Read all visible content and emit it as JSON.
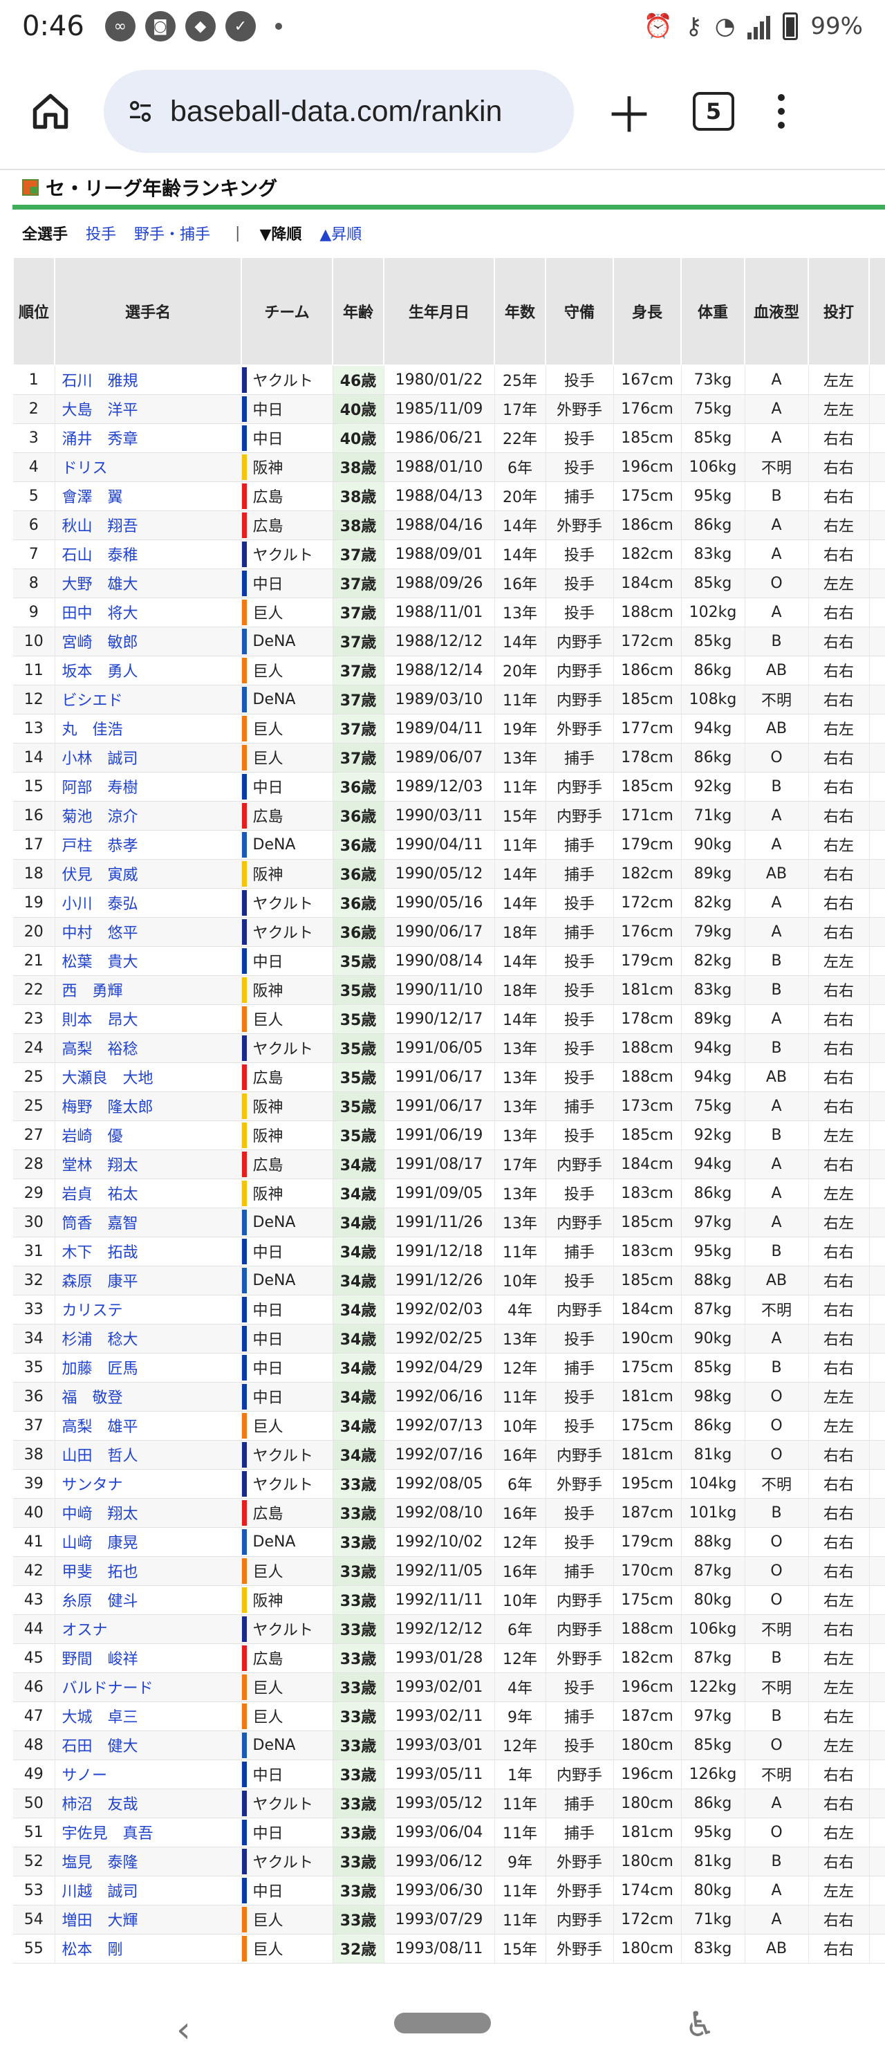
{
  "status": {
    "time": "0:46",
    "battery": "99%"
  },
  "browser": {
    "url": "baseball-data.com/rankin",
    "tab_count": "5"
  },
  "page": {
    "title": "セ・リーグ年齢ランキング",
    "filters": {
      "all": "全選手",
      "pitcher": "投手",
      "fielder": "野手・捕手",
      "sep": "|",
      "desc": "▼降順",
      "asc": "▲昇順"
    }
  },
  "table": {
    "headers": [
      "順位",
      "選手名",
      "チーム",
      "年齢",
      "生年月日",
      "年数",
      "守備",
      "身長",
      "体重",
      "血液型",
      "投打"
    ],
    "team_colors": {
      "ヤクルト": "#1a2a8c",
      "中日": "#0a3aa8",
      "阪神": "#f2c40a",
      "広島": "#e61e1e",
      "巨人": "#f07a10",
      "DeNA": "#1a5ab4"
    },
    "rows": [
      [
        "1",
        "石川　雅規",
        "ヤクルト",
        "46歳",
        "1980/01/22",
        "25年",
        "投手",
        "167cm",
        "73kg",
        "A",
        "左左"
      ],
      [
        "2",
        "大島　洋平",
        "中日",
        "40歳",
        "1985/11/09",
        "17年",
        "外野手",
        "176cm",
        "75kg",
        "A",
        "左左"
      ],
      [
        "3",
        "涌井　秀章",
        "中日",
        "40歳",
        "1986/06/21",
        "22年",
        "投手",
        "185cm",
        "85kg",
        "A",
        "右右"
      ],
      [
        "4",
        "ドリス",
        "阪神",
        "38歳",
        "1988/01/10",
        "6年",
        "投手",
        "196cm",
        "106kg",
        "不明",
        "右右"
      ],
      [
        "5",
        "會澤　翼",
        "広島",
        "38歳",
        "1988/04/13",
        "20年",
        "捕手",
        "175cm",
        "95kg",
        "B",
        "右右"
      ],
      [
        "6",
        "秋山　翔吾",
        "広島",
        "38歳",
        "1988/04/16",
        "14年",
        "外野手",
        "186cm",
        "86kg",
        "A",
        "右左"
      ],
      [
        "7",
        "石山　泰稚",
        "ヤクルト",
        "37歳",
        "1988/09/01",
        "14年",
        "投手",
        "182cm",
        "83kg",
        "A",
        "右右"
      ],
      [
        "8",
        "大野　雄大",
        "中日",
        "37歳",
        "1988/09/26",
        "16年",
        "投手",
        "184cm",
        "85kg",
        "O",
        "左左"
      ],
      [
        "9",
        "田中　将大",
        "巨人",
        "37歳",
        "1988/11/01",
        "13年",
        "投手",
        "188cm",
        "102kg",
        "A",
        "右右"
      ],
      [
        "10",
        "宮崎　敏郎",
        "DeNA",
        "37歳",
        "1988/12/12",
        "14年",
        "内野手",
        "172cm",
        "85kg",
        "B",
        "右右"
      ],
      [
        "11",
        "坂本　勇人",
        "巨人",
        "37歳",
        "1988/12/14",
        "20年",
        "内野手",
        "186cm",
        "86kg",
        "AB",
        "右右"
      ],
      [
        "12",
        "ビシエド",
        "DeNA",
        "37歳",
        "1989/03/10",
        "11年",
        "内野手",
        "185cm",
        "108kg",
        "不明",
        "右右"
      ],
      [
        "13",
        "丸　佳浩",
        "巨人",
        "37歳",
        "1989/04/11",
        "19年",
        "外野手",
        "177cm",
        "94kg",
        "AB",
        "右左"
      ],
      [
        "14",
        "小林　誠司",
        "巨人",
        "37歳",
        "1989/06/07",
        "13年",
        "捕手",
        "178cm",
        "86kg",
        "O",
        "右右"
      ],
      [
        "15",
        "阿部　寿樹",
        "中日",
        "36歳",
        "1989/12/03",
        "11年",
        "内野手",
        "185cm",
        "92kg",
        "B",
        "右右"
      ],
      [
        "16",
        "菊池　涼介",
        "広島",
        "36歳",
        "1990/03/11",
        "15年",
        "内野手",
        "171cm",
        "71kg",
        "A",
        "右右"
      ],
      [
        "17",
        "戸柱　恭孝",
        "DeNA",
        "36歳",
        "1990/04/11",
        "11年",
        "捕手",
        "179cm",
        "90kg",
        "A",
        "右左"
      ],
      [
        "18",
        "伏見　寅威",
        "阪神",
        "36歳",
        "1990/05/12",
        "14年",
        "捕手",
        "182cm",
        "89kg",
        "AB",
        "右右"
      ],
      [
        "19",
        "小川　泰弘",
        "ヤクルト",
        "36歳",
        "1990/05/16",
        "14年",
        "投手",
        "172cm",
        "82kg",
        "A",
        "右右"
      ],
      [
        "20",
        "中村　悠平",
        "ヤクルト",
        "36歳",
        "1990/06/17",
        "18年",
        "捕手",
        "176cm",
        "79kg",
        "A",
        "右右"
      ],
      [
        "21",
        "松葉　貴大",
        "中日",
        "35歳",
        "1990/08/14",
        "14年",
        "投手",
        "179cm",
        "82kg",
        "B",
        "左左"
      ],
      [
        "22",
        "西　勇輝",
        "阪神",
        "35歳",
        "1990/11/10",
        "18年",
        "投手",
        "181cm",
        "83kg",
        "B",
        "右右"
      ],
      [
        "23",
        "則本　昂大",
        "巨人",
        "35歳",
        "1990/12/17",
        "14年",
        "投手",
        "178cm",
        "89kg",
        "A",
        "右右"
      ],
      [
        "24",
        "高梨　裕稔",
        "ヤクルト",
        "35歳",
        "1991/06/05",
        "13年",
        "投手",
        "188cm",
        "94kg",
        "B",
        "右右"
      ],
      [
        "25",
        "大瀬良　大地",
        "広島",
        "35歳",
        "1991/06/17",
        "13年",
        "投手",
        "188cm",
        "94kg",
        "AB",
        "右右"
      ],
      [
        "25",
        "梅野　隆太郎",
        "阪神",
        "35歳",
        "1991/06/17",
        "13年",
        "捕手",
        "173cm",
        "75kg",
        "A",
        "右右"
      ],
      [
        "27",
        "岩崎　優",
        "阪神",
        "35歳",
        "1991/06/19",
        "13年",
        "投手",
        "185cm",
        "92kg",
        "B",
        "左左"
      ],
      [
        "28",
        "堂林　翔太",
        "広島",
        "34歳",
        "1991/08/17",
        "17年",
        "内野手",
        "184cm",
        "94kg",
        "A",
        "右右"
      ],
      [
        "29",
        "岩貞　祐太",
        "阪神",
        "34歳",
        "1991/09/05",
        "13年",
        "投手",
        "183cm",
        "86kg",
        "A",
        "左左"
      ],
      [
        "30",
        "筒香　嘉智",
        "DeNA",
        "34歳",
        "1991/11/26",
        "13年",
        "内野手",
        "185cm",
        "97kg",
        "A",
        "右左"
      ],
      [
        "31",
        "木下　拓哉",
        "中日",
        "34歳",
        "1991/12/18",
        "11年",
        "捕手",
        "183cm",
        "95kg",
        "B",
        "右右"
      ],
      [
        "32",
        "森原　康平",
        "DeNA",
        "34歳",
        "1991/12/26",
        "10年",
        "投手",
        "185cm",
        "88kg",
        "AB",
        "右右"
      ],
      [
        "33",
        "カリステ",
        "中日",
        "34歳",
        "1992/02/03",
        "4年",
        "内野手",
        "184cm",
        "87kg",
        "不明",
        "右右"
      ],
      [
        "34",
        "杉浦　稔大",
        "中日",
        "34歳",
        "1992/02/25",
        "13年",
        "投手",
        "190cm",
        "90kg",
        "A",
        "右右"
      ],
      [
        "35",
        "加藤　匠馬",
        "中日",
        "34歳",
        "1992/04/29",
        "12年",
        "捕手",
        "175cm",
        "85kg",
        "B",
        "右右"
      ],
      [
        "36",
        "福　敬登",
        "中日",
        "34歳",
        "1992/06/16",
        "11年",
        "投手",
        "181cm",
        "98kg",
        "O",
        "左左"
      ],
      [
        "37",
        "高梨　雄平",
        "巨人",
        "34歳",
        "1992/07/13",
        "10年",
        "投手",
        "175cm",
        "86kg",
        "O",
        "左左"
      ],
      [
        "38",
        "山田　哲人",
        "ヤクルト",
        "34歳",
        "1992/07/16",
        "16年",
        "内野手",
        "181cm",
        "81kg",
        "O",
        "右右"
      ],
      [
        "39",
        "サンタナ",
        "ヤクルト",
        "33歳",
        "1992/08/05",
        "6年",
        "外野手",
        "195cm",
        "104kg",
        "不明",
        "右右"
      ],
      [
        "40",
        "中﨑　翔太",
        "広島",
        "33歳",
        "1992/08/10",
        "16年",
        "投手",
        "187cm",
        "101kg",
        "B",
        "右右"
      ],
      [
        "41",
        "山﨑　康晃",
        "DeNA",
        "33歳",
        "1992/10/02",
        "12年",
        "投手",
        "179cm",
        "88kg",
        "O",
        "右右"
      ],
      [
        "42",
        "甲斐　拓也",
        "巨人",
        "33歳",
        "1992/11/05",
        "16年",
        "捕手",
        "170cm",
        "87kg",
        "O",
        "右右"
      ],
      [
        "43",
        "糸原　健斗",
        "阪神",
        "33歳",
        "1992/11/11",
        "10年",
        "内野手",
        "175cm",
        "80kg",
        "O",
        "右左"
      ],
      [
        "44",
        "オスナ",
        "ヤクルト",
        "33歳",
        "1992/12/12",
        "6年",
        "内野手",
        "188cm",
        "106kg",
        "不明",
        "右右"
      ],
      [
        "45",
        "野間　峻祥",
        "広島",
        "33歳",
        "1993/01/28",
        "12年",
        "外野手",
        "182cm",
        "87kg",
        "B",
        "右左"
      ],
      [
        "46",
        "バルドナード",
        "巨人",
        "33歳",
        "1993/02/01",
        "4年",
        "投手",
        "196cm",
        "122kg",
        "不明",
        "左左"
      ],
      [
        "47",
        "大城　卓三",
        "巨人",
        "33歳",
        "1993/02/11",
        "9年",
        "捕手",
        "187cm",
        "97kg",
        "B",
        "右左"
      ],
      [
        "48",
        "石田　健大",
        "DeNA",
        "33歳",
        "1993/03/01",
        "12年",
        "投手",
        "180cm",
        "85kg",
        "O",
        "左左"
      ],
      [
        "49",
        "サノー",
        "中日",
        "33歳",
        "1993/05/11",
        "1年",
        "内野手",
        "196cm",
        "126kg",
        "不明",
        "右右"
      ],
      [
        "50",
        "柿沼　友哉",
        "ヤクルト",
        "33歳",
        "1993/05/12",
        "11年",
        "捕手",
        "180cm",
        "86kg",
        "A",
        "右右"
      ],
      [
        "51",
        "宇佐見　真吾",
        "中日",
        "33歳",
        "1993/06/04",
        "11年",
        "捕手",
        "181cm",
        "95kg",
        "O",
        "右左"
      ],
      [
        "52",
        "塩見　泰隆",
        "ヤクルト",
        "33歳",
        "1993/06/12",
        "9年",
        "外野手",
        "180cm",
        "81kg",
        "B",
        "右右"
      ],
      [
        "53",
        "川越　誠司",
        "中日",
        "33歳",
        "1993/06/30",
        "11年",
        "外野手",
        "174cm",
        "80kg",
        "A",
        "左左"
      ],
      [
        "54",
        "増田　大輝",
        "巨人",
        "33歳",
        "1993/07/29",
        "11年",
        "内野手",
        "172cm",
        "71kg",
        "A",
        "右右"
      ],
      [
        "55",
        "松本　剛",
        "巨人",
        "32歳",
        "1993/08/11",
        "15年",
        "外野手",
        "180cm",
        "83kg",
        "AB",
        "右右"
      ]
    ]
  },
  "system_nav": {
    "back": "‹",
    "accessibility": "♿"
  }
}
